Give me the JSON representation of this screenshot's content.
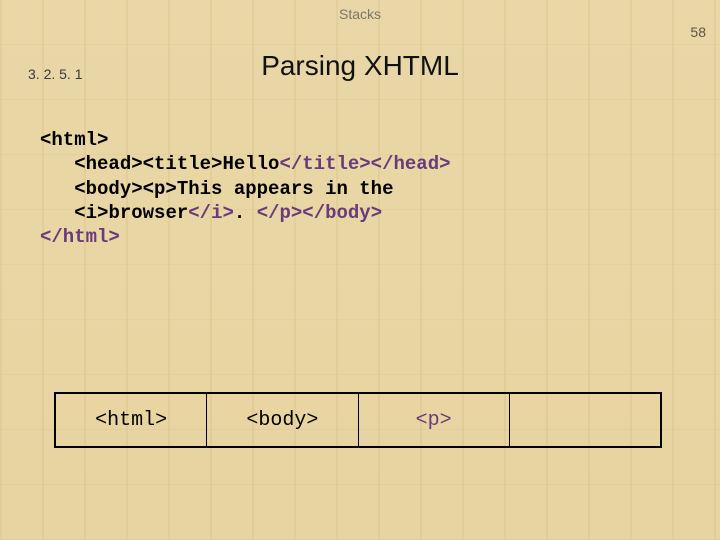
{
  "header": {
    "topic": "Stacks",
    "page_number": "58",
    "section_number": "3. 2. 5. 1",
    "title": "Parsing XHTML"
  },
  "code": {
    "l1_open": "<html>",
    "l2_indent": "   ",
    "l2_open": "<head><title>",
    "l2_text": "Hello",
    "l2_close": "</title></head>",
    "l3_indent": "   ",
    "l3_open": "<body><p>",
    "l3_text": "This appears in the",
    "l4_indent": "   ",
    "l4_open": "<i>",
    "l4_text": "browser",
    "l4_close1": "</i>",
    "l4_mid": ". ",
    "l4_close2": "</p></body>",
    "l5_close": "</html>"
  },
  "stack": {
    "cells": [
      {
        "text": "<html>",
        "kind": "open"
      },
      {
        "text": "<body>",
        "kind": "open"
      },
      {
        "text": "<p>",
        "kind": "close"
      },
      {
        "text": "",
        "kind": "open"
      }
    ]
  }
}
